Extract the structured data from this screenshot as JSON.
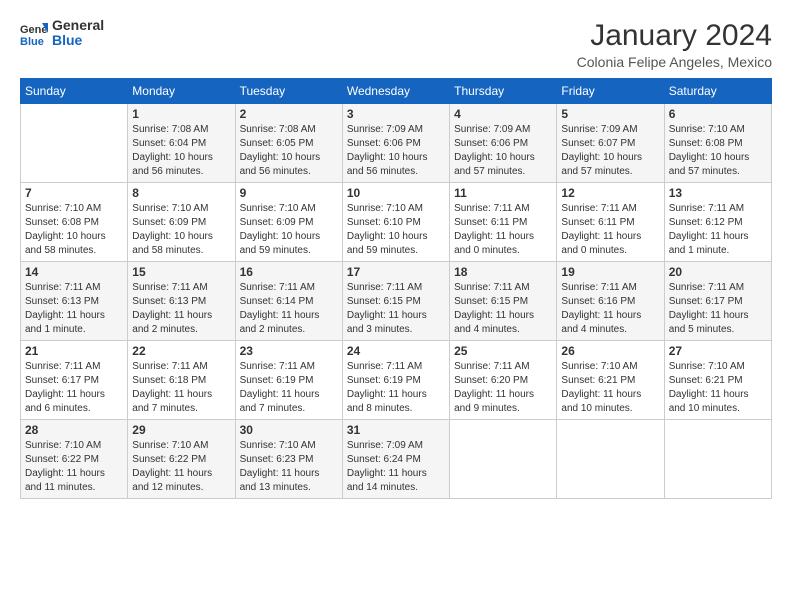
{
  "logo": {
    "general": "General",
    "blue": "Blue"
  },
  "header": {
    "title": "January 2024",
    "subtitle": "Colonia Felipe Angeles, Mexico"
  },
  "days_of_week": [
    "Sunday",
    "Monday",
    "Tuesday",
    "Wednesday",
    "Thursday",
    "Friday",
    "Saturday"
  ],
  "weeks": [
    [
      {
        "day": "",
        "sunrise": "",
        "sunset": "",
        "daylight": ""
      },
      {
        "day": "1",
        "sunrise": "Sunrise: 7:08 AM",
        "sunset": "Sunset: 6:04 PM",
        "daylight": "Daylight: 10 hours and 56 minutes."
      },
      {
        "day": "2",
        "sunrise": "Sunrise: 7:08 AM",
        "sunset": "Sunset: 6:05 PM",
        "daylight": "Daylight: 10 hours and 56 minutes."
      },
      {
        "day": "3",
        "sunrise": "Sunrise: 7:09 AM",
        "sunset": "Sunset: 6:06 PM",
        "daylight": "Daylight: 10 hours and 56 minutes."
      },
      {
        "day": "4",
        "sunrise": "Sunrise: 7:09 AM",
        "sunset": "Sunset: 6:06 PM",
        "daylight": "Daylight: 10 hours and 57 minutes."
      },
      {
        "day": "5",
        "sunrise": "Sunrise: 7:09 AM",
        "sunset": "Sunset: 6:07 PM",
        "daylight": "Daylight: 10 hours and 57 minutes."
      },
      {
        "day": "6",
        "sunrise": "Sunrise: 7:10 AM",
        "sunset": "Sunset: 6:08 PM",
        "daylight": "Daylight: 10 hours and 57 minutes."
      }
    ],
    [
      {
        "day": "7",
        "sunrise": "Sunrise: 7:10 AM",
        "sunset": "Sunset: 6:08 PM",
        "daylight": "Daylight: 10 hours and 58 minutes."
      },
      {
        "day": "8",
        "sunrise": "Sunrise: 7:10 AM",
        "sunset": "Sunset: 6:09 PM",
        "daylight": "Daylight: 10 hours and 58 minutes."
      },
      {
        "day": "9",
        "sunrise": "Sunrise: 7:10 AM",
        "sunset": "Sunset: 6:09 PM",
        "daylight": "Daylight: 10 hours and 59 minutes."
      },
      {
        "day": "10",
        "sunrise": "Sunrise: 7:10 AM",
        "sunset": "Sunset: 6:10 PM",
        "daylight": "Daylight: 10 hours and 59 minutes."
      },
      {
        "day": "11",
        "sunrise": "Sunrise: 7:11 AM",
        "sunset": "Sunset: 6:11 PM",
        "daylight": "Daylight: 11 hours and 0 minutes."
      },
      {
        "day": "12",
        "sunrise": "Sunrise: 7:11 AM",
        "sunset": "Sunset: 6:11 PM",
        "daylight": "Daylight: 11 hours and 0 minutes."
      },
      {
        "day": "13",
        "sunrise": "Sunrise: 7:11 AM",
        "sunset": "Sunset: 6:12 PM",
        "daylight": "Daylight: 11 hours and 1 minute."
      }
    ],
    [
      {
        "day": "14",
        "sunrise": "Sunrise: 7:11 AM",
        "sunset": "Sunset: 6:13 PM",
        "daylight": "Daylight: 11 hours and 1 minute."
      },
      {
        "day": "15",
        "sunrise": "Sunrise: 7:11 AM",
        "sunset": "Sunset: 6:13 PM",
        "daylight": "Daylight: 11 hours and 2 minutes."
      },
      {
        "day": "16",
        "sunrise": "Sunrise: 7:11 AM",
        "sunset": "Sunset: 6:14 PM",
        "daylight": "Daylight: 11 hours and 2 minutes."
      },
      {
        "day": "17",
        "sunrise": "Sunrise: 7:11 AM",
        "sunset": "Sunset: 6:15 PM",
        "daylight": "Daylight: 11 hours and 3 minutes."
      },
      {
        "day": "18",
        "sunrise": "Sunrise: 7:11 AM",
        "sunset": "Sunset: 6:15 PM",
        "daylight": "Daylight: 11 hours and 4 minutes."
      },
      {
        "day": "19",
        "sunrise": "Sunrise: 7:11 AM",
        "sunset": "Sunset: 6:16 PM",
        "daylight": "Daylight: 11 hours and 4 minutes."
      },
      {
        "day": "20",
        "sunrise": "Sunrise: 7:11 AM",
        "sunset": "Sunset: 6:17 PM",
        "daylight": "Daylight: 11 hours and 5 minutes."
      }
    ],
    [
      {
        "day": "21",
        "sunrise": "Sunrise: 7:11 AM",
        "sunset": "Sunset: 6:17 PM",
        "daylight": "Daylight: 11 hours and 6 minutes."
      },
      {
        "day": "22",
        "sunrise": "Sunrise: 7:11 AM",
        "sunset": "Sunset: 6:18 PM",
        "daylight": "Daylight: 11 hours and 7 minutes."
      },
      {
        "day": "23",
        "sunrise": "Sunrise: 7:11 AM",
        "sunset": "Sunset: 6:19 PM",
        "daylight": "Daylight: 11 hours and 7 minutes."
      },
      {
        "day": "24",
        "sunrise": "Sunrise: 7:11 AM",
        "sunset": "Sunset: 6:19 PM",
        "daylight": "Daylight: 11 hours and 8 minutes."
      },
      {
        "day": "25",
        "sunrise": "Sunrise: 7:11 AM",
        "sunset": "Sunset: 6:20 PM",
        "daylight": "Daylight: 11 hours and 9 minutes."
      },
      {
        "day": "26",
        "sunrise": "Sunrise: 7:10 AM",
        "sunset": "Sunset: 6:21 PM",
        "daylight": "Daylight: 11 hours and 10 minutes."
      },
      {
        "day": "27",
        "sunrise": "Sunrise: 7:10 AM",
        "sunset": "Sunset: 6:21 PM",
        "daylight": "Daylight: 11 hours and 10 minutes."
      }
    ],
    [
      {
        "day": "28",
        "sunrise": "Sunrise: 7:10 AM",
        "sunset": "Sunset: 6:22 PM",
        "daylight": "Daylight: 11 hours and 11 minutes."
      },
      {
        "day": "29",
        "sunrise": "Sunrise: 7:10 AM",
        "sunset": "Sunset: 6:22 PM",
        "daylight": "Daylight: 11 hours and 12 minutes."
      },
      {
        "day": "30",
        "sunrise": "Sunrise: 7:10 AM",
        "sunset": "Sunset: 6:23 PM",
        "daylight": "Daylight: 11 hours and 13 minutes."
      },
      {
        "day": "31",
        "sunrise": "Sunrise: 7:09 AM",
        "sunset": "Sunset: 6:24 PM",
        "daylight": "Daylight: 11 hours and 14 minutes."
      },
      {
        "day": "",
        "sunrise": "",
        "sunset": "",
        "daylight": ""
      },
      {
        "day": "",
        "sunrise": "",
        "sunset": "",
        "daylight": ""
      },
      {
        "day": "",
        "sunrise": "",
        "sunset": "",
        "daylight": ""
      }
    ]
  ]
}
